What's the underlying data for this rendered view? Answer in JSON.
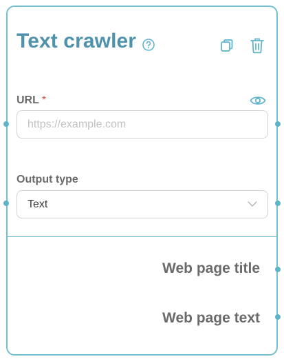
{
  "node": {
    "title": "Text crawler",
    "icons": {
      "help": "help-circle-icon",
      "copy": "copy-icon",
      "delete": "trash-icon",
      "visibility": "eye-icon",
      "dropdown": "chevron-down-icon"
    },
    "url_field": {
      "label": "URL",
      "required_mark": "*",
      "value": "",
      "placeholder": "https://example.com"
    },
    "output_type": {
      "label": "Output type",
      "selected": "Text"
    },
    "outputs": [
      {
        "label": "Web page title"
      },
      {
        "label": "Web page text"
      }
    ]
  },
  "colors": {
    "accent": "#74c0d2",
    "title": "#4f92ab",
    "handle": "#5fb4cc",
    "required": "#d9534f"
  }
}
